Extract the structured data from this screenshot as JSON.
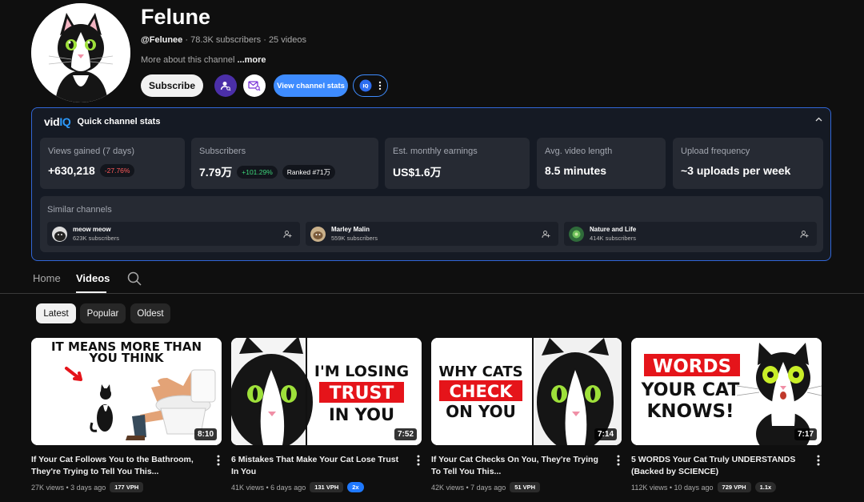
{
  "channel": {
    "name": "Felune",
    "handle": "@Felunee",
    "subscribers": "78.3K subscribers",
    "videos_count": "25 videos",
    "separator": "·",
    "about": "More about this channel",
    "about_more": "...more",
    "subscribe_label": "Subscribe",
    "view_stats_label": "View channel stats"
  },
  "stats_panel": {
    "brand_left": "vid",
    "brand_right": "IQ",
    "title": "Quick channel stats",
    "cards": [
      {
        "label": "Views gained (7 days)",
        "value": "+630,218",
        "chip": "-27.76%"
      },
      {
        "label": "Subscribers",
        "value": "7.79万",
        "chip": "+101.29%",
        "chip2": "Ranked #71万"
      },
      {
        "label": "Est. monthly earnings",
        "value": "US$1.6万"
      },
      {
        "label": "Avg. video length",
        "value": "8.5 minutes"
      },
      {
        "label": "Upload frequency",
        "value": "~3 uploads per week"
      }
    ],
    "similar_label": "Similar channels",
    "similar": [
      {
        "name": "meow meow",
        "subs": "623K subscribers"
      },
      {
        "name": "Marley Malin",
        "subs": "559K subscribers"
      },
      {
        "name": "Nature and Life",
        "subs": "414K subscribers"
      }
    ]
  },
  "tabs": [
    {
      "label": "Home"
    },
    {
      "label": "Videos"
    }
  ],
  "filters": [
    {
      "label": "Latest"
    },
    {
      "label": "Popular"
    },
    {
      "label": "Oldest"
    }
  ],
  "videos": [
    {
      "title": "If Your Cat Follows You to the Bathroom, They're Trying to Tell You This...",
      "views": "27K views • 3 days ago",
      "vph": "177 VPH",
      "multiplier": "",
      "duration": "8:10",
      "thumb_text": [
        "IT MEANS MORE THAN",
        "YOU THINK"
      ]
    },
    {
      "title": "6 Mistakes That Make Your Cat Lose Trust In You",
      "views": "41K views • 6 days ago",
      "vph": "131 VPH",
      "multiplier": "2x",
      "duration": "7:52",
      "thumb_text": [
        "I'M LOSING",
        "TRUST",
        "IN YOU"
      ]
    },
    {
      "title": "If Your Cat Checks On You, They're Trying To Tell You This...",
      "views": "42K views • 7 days ago",
      "vph": "51 VPH",
      "multiplier": "",
      "duration": "7:14",
      "thumb_text": [
        "WHY CATS",
        "CHECK",
        "ON YOU"
      ]
    },
    {
      "title": "5 WORDS Your Cat Truly UNDERSTANDS (Backed by SCIENCE)",
      "views": "112K views • 10 days ago",
      "vph": "729 VPH",
      "multiplier": "1.1x",
      "duration": "7:17",
      "thumb_text": [
        "WORDS",
        "YOUR CAT",
        "KNOWS!"
      ]
    }
  ],
  "colors": {
    "accent_blue": "#3e8cff",
    "panel_border": "#3166d6",
    "negative": "#ff5a5a",
    "positive": "#3dd67a",
    "thumb_red": "#e5141a"
  },
  "icons": {
    "profile_search": "person-search-icon",
    "mail": "mail-search-icon",
    "vidiq": "vidiq-icon",
    "more": "more-vert-icon",
    "collapse": "chevron-up-icon",
    "search": "search-icon",
    "add_person": "person-add-icon"
  }
}
